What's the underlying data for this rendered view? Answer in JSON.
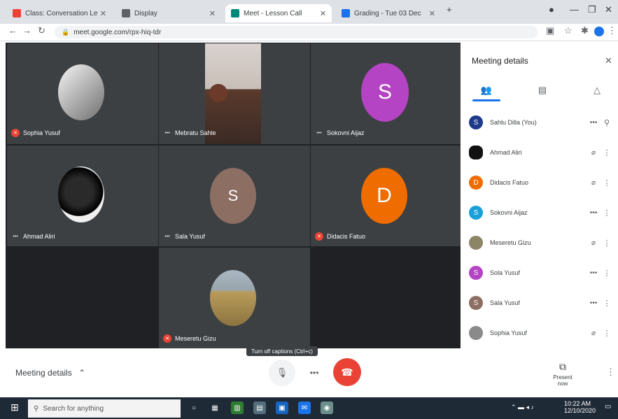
{
  "browser": {
    "tabs": [
      {
        "title": "Class: Conversation Lesson",
        "fav_color": "#ea4335"
      },
      {
        "title": "Display",
        "fav_color": "#5f6368"
      },
      {
        "title": "Meet - Lesson Call",
        "fav_color": "#00897b"
      },
      {
        "title": "Grading - Tue 03 Dec",
        "fav_color": "#1a73e8"
      }
    ],
    "url": "meet.google.com/rpx-hiq-tdr",
    "window_controls": [
      "—",
      "❐",
      "✕"
    ]
  },
  "tiles": [
    {
      "name": "Sophia Yusuf",
      "initial": "",
      "color": "#8a8a8a",
      "muted": true,
      "kind": "photo-light"
    },
    {
      "name": "Mebratu Sahle",
      "initial": "",
      "color": "#6b5a52",
      "muted": false,
      "kind": "video"
    },
    {
      "name": "Sokovni Aijaz",
      "initial": "S",
      "color": "#b544c4",
      "muted": false,
      "kind": "letter"
    },
    {
      "name": "Ahmad Aliri",
      "initial": "",
      "color": "#111111",
      "muted": false,
      "kind": "photo-dark"
    },
    {
      "name": "Sala Yusuf",
      "initial": "S",
      "color": "#8d6e63",
      "muted": false,
      "kind": "letter"
    },
    {
      "name": "Didacis Fatuo",
      "initial": "D",
      "color": "#ef6c00",
      "muted": true,
      "kind": "letter"
    },
    {
      "name": "Meseretu Gizu",
      "initial": "",
      "color": "#8c8566",
      "muted": true,
      "kind": "photo-landscape"
    }
  ],
  "panel": {
    "title": "Meeting details",
    "tab_icons": [
      "people-icon",
      "chat-icon",
      "activities-icon"
    ],
    "participants": [
      {
        "name": "Sahlu Dilla (You)",
        "initial": "S",
        "color": "#1e3a8a"
      },
      {
        "name": "Ahmad Aliri",
        "initial": "",
        "color": "#111111"
      },
      {
        "name": "Didacis Fatuo",
        "initial": "D",
        "color": "#ef6c00"
      },
      {
        "name": "Sokovni Aijaz",
        "initial": "S",
        "color": "#1aa0d8"
      },
      {
        "name": "Meseretu Gizu",
        "initial": "",
        "color": "#8c8566"
      },
      {
        "name": "Sola Yusuf",
        "initial": "S",
        "color": "#b544c4"
      },
      {
        "name": "Sala Yusuf",
        "initial": "S",
        "color": "#8d6e63"
      },
      {
        "name": "Sophia Yusuf",
        "initial": "",
        "color": "#8a8a8a"
      }
    ]
  },
  "bottombar": {
    "meeting_details_label": "Meeting details",
    "tooltip": "Turn off captions (Ctrl+c)",
    "present_label": "Present now",
    "end_call_color": "#ea4335"
  },
  "taskbar": {
    "search_placeholder": "Search for anything",
    "time": "10:22 AM",
    "date": "12/10/2020"
  }
}
